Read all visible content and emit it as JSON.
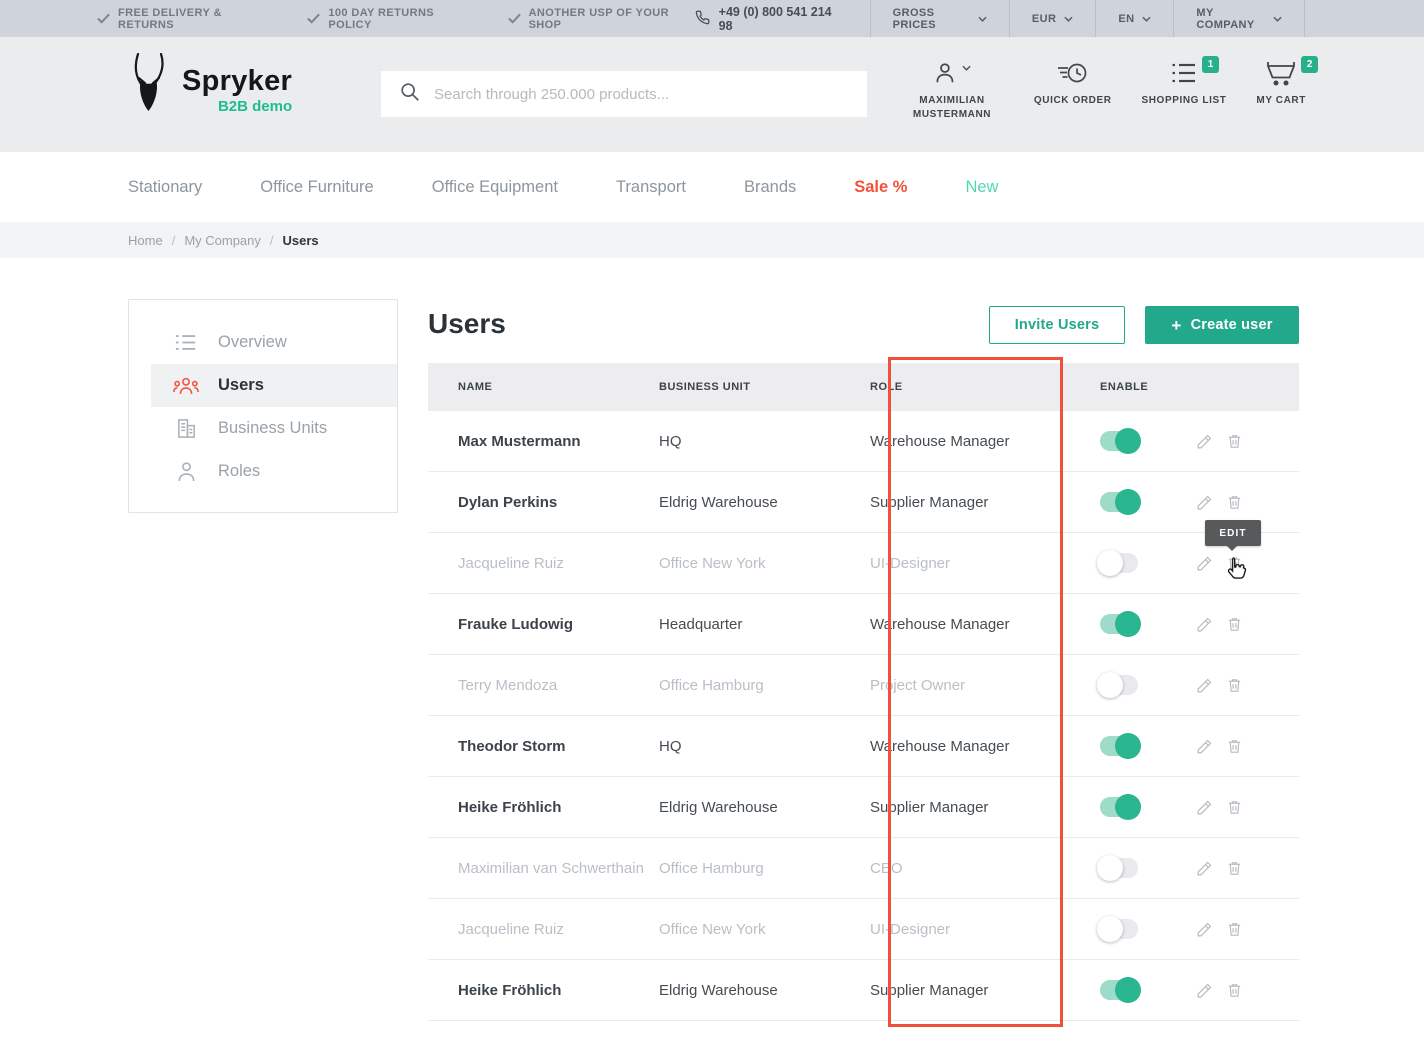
{
  "topbar": {
    "usps": [
      "FREE DELIVERY & RETURNS",
      "100 DAY RETURNS POLICY",
      "ANOTHER USP OF YOUR SHOP"
    ],
    "phone": "+49 (0) 800 541 214 98",
    "menus": [
      {
        "label": "GROSS PRICES"
      },
      {
        "label": "EUR"
      },
      {
        "label": "EN"
      },
      {
        "label": "MY COMPANY"
      }
    ]
  },
  "header": {
    "brand": {
      "name": "Spryker",
      "tagline": "B2B demo"
    },
    "search_placeholder": "Search through 250.000 products...",
    "account_label": "MAXIMILIAN MUSTERMANN",
    "quick_order_label": "QUICK ORDER",
    "shopping_list": {
      "label": "SHOPPING LIST",
      "badge": "1"
    },
    "cart": {
      "label": "MY CART",
      "badge": "2"
    }
  },
  "nav": {
    "items": [
      {
        "label": "Stationary"
      },
      {
        "label": "Office Furniture"
      },
      {
        "label": "Office Equipment"
      },
      {
        "label": "Transport"
      },
      {
        "label": "Brands"
      },
      {
        "label": "Sale %",
        "color": "#f4513c",
        "bold": true
      },
      {
        "label": "New",
        "color": "#56d5b2"
      }
    ]
  },
  "breadcrumb": {
    "items": [
      "Home",
      "My Company",
      "Users"
    ]
  },
  "sidebar": {
    "items": [
      {
        "label": "Overview",
        "icon": "list-icon",
        "active": false
      },
      {
        "label": "Users",
        "icon": "users-icon",
        "active": true
      },
      {
        "label": "Business Units",
        "icon": "building-icon",
        "active": false
      },
      {
        "label": "Roles",
        "icon": "person-icon",
        "active": false
      }
    ]
  },
  "main": {
    "title": "Users",
    "invite_button": "Invite Users",
    "create_button": "Create user",
    "table": {
      "columns": [
        "NAME",
        "BUSINESS UNIT",
        "ROLE",
        "ENABLE"
      ],
      "rows": [
        {
          "name": "Max Mustermann",
          "business_unit": "HQ",
          "role": "Warehouse Manager",
          "enabled": true
        },
        {
          "name": "Dylan Perkins",
          "business_unit": "Eldrig Warehouse",
          "role": "Supplier Manager",
          "enabled": true
        },
        {
          "name": "Jacqueline Ruiz",
          "business_unit": "Office New York",
          "role": "UI-Designer",
          "enabled": false
        },
        {
          "name": "Frauke Ludowig",
          "business_unit": "Headquarter",
          "role": "Warehouse Manager",
          "enabled": true
        },
        {
          "name": "Terry Mendoza",
          "business_unit": "Office Hamburg",
          "role": "Project Owner",
          "enabled": false
        },
        {
          "name": "Theodor Storm",
          "business_unit": "HQ",
          "role": "Warehouse Manager",
          "enabled": true
        },
        {
          "name": "Heike Fröhlich",
          "business_unit": "Eldrig Warehouse",
          "role": "Supplier Manager",
          "enabled": true
        },
        {
          "name": "Maximilian van Schwerthain",
          "business_unit": "Office Hamburg",
          "role": "CEO",
          "enabled": false
        },
        {
          "name": "Jacqueline Ruiz",
          "business_unit": "Office New York",
          "role": "UI-Designer",
          "enabled": false
        },
        {
          "name": "Heike Fröhlich",
          "business_unit": "Eldrig Warehouse",
          "role": "Supplier Manager",
          "enabled": true
        }
      ]
    },
    "tooltip": "EDIT"
  },
  "colors": {
    "accent_teal": "#22a98c",
    "badge_teal": "#27b08b",
    "toggle_on_knob": "#2ab691",
    "toggle_on_track": "#9edcc9",
    "sidebar_active_icon": "#f0543c",
    "highlight_red": "#f0503c",
    "sale_red": "#f4513c",
    "new_teal": "#56d5b2",
    "topbar_bg": "#cfd4db",
    "header_bg": "#eaecee"
  }
}
